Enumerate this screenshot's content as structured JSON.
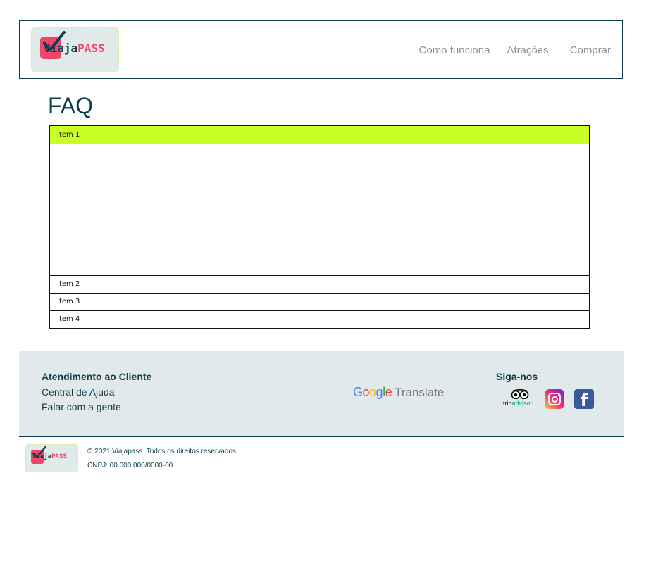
{
  "header": {
    "logo": {
      "letter": "V",
      "middle": "iaja",
      "highlight": "PASS"
    },
    "nav": [
      "Como funciona",
      "Atrações",
      "Comprar"
    ]
  },
  "faq": {
    "title": "FAQ",
    "items": [
      {
        "label": "Item 1",
        "open": true
      },
      {
        "label": "Item 2",
        "open": false
      },
      {
        "label": "Item 3",
        "open": false
      },
      {
        "label": "Item 4",
        "open": false
      }
    ]
  },
  "footer": {
    "support_heading": "Atendimento ao Cliente",
    "links": [
      "Central de Ajuda",
      "Falar com a gente"
    ],
    "translate": {
      "google": "Google",
      "word": "Translate"
    },
    "social_heading": "Siga-nos",
    "tripadvisor": {
      "trip": "trip",
      "advisor": "advisor"
    },
    "facebook_glyph": "f"
  },
  "bottom": {
    "logo": {
      "letter": "V",
      "middle": "iaja",
      "highlight": "PASS"
    },
    "copyright": "© 2021 Viajapass. Todos os direitos reservados",
    "cnpj": "CNPJ: 00.000.000/0000-00"
  },
  "colors": {
    "primary": "#0e3e4f",
    "accent": "#f0466a",
    "active": "#c8ff24",
    "footer_bg": "#e2e9eb"
  }
}
